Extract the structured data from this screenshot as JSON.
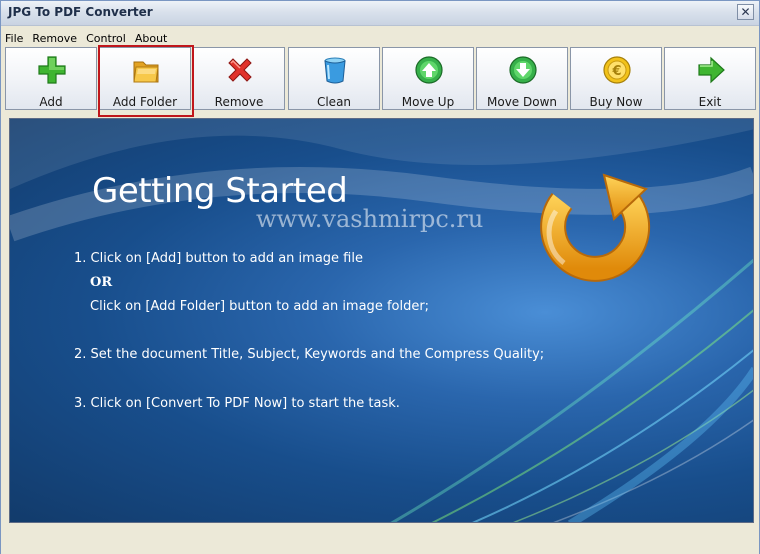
{
  "window": {
    "title": "JPG To PDF Converter"
  },
  "menu": [
    "File",
    "Remove",
    "Control",
    "About"
  ],
  "toolbar": {
    "add": "Add",
    "add_folder": "Add Folder",
    "remove": "Remove",
    "clean": "Clean",
    "move_up": "Move Up",
    "move_down": "Move Down",
    "buy_now": "Buy Now",
    "exit": "Exit"
  },
  "getting_started": {
    "title": "Getting Started",
    "watermark": "www.vashmirpc.ru",
    "step1": "1. Click on [Add] button to add an image file",
    "or": "OR",
    "step1b": "Click on [Add Folder] button to add an image folder;",
    "step2": "2. Set the document Title, Subject, Keywords and the Compress Quality;",
    "step3": "3. Click on [Convert To PDF Now] to start the task."
  },
  "colors": {
    "highlight": "#c0161b",
    "background_blue": "#1a4f8d",
    "refresh_orange": "#f2a818"
  }
}
